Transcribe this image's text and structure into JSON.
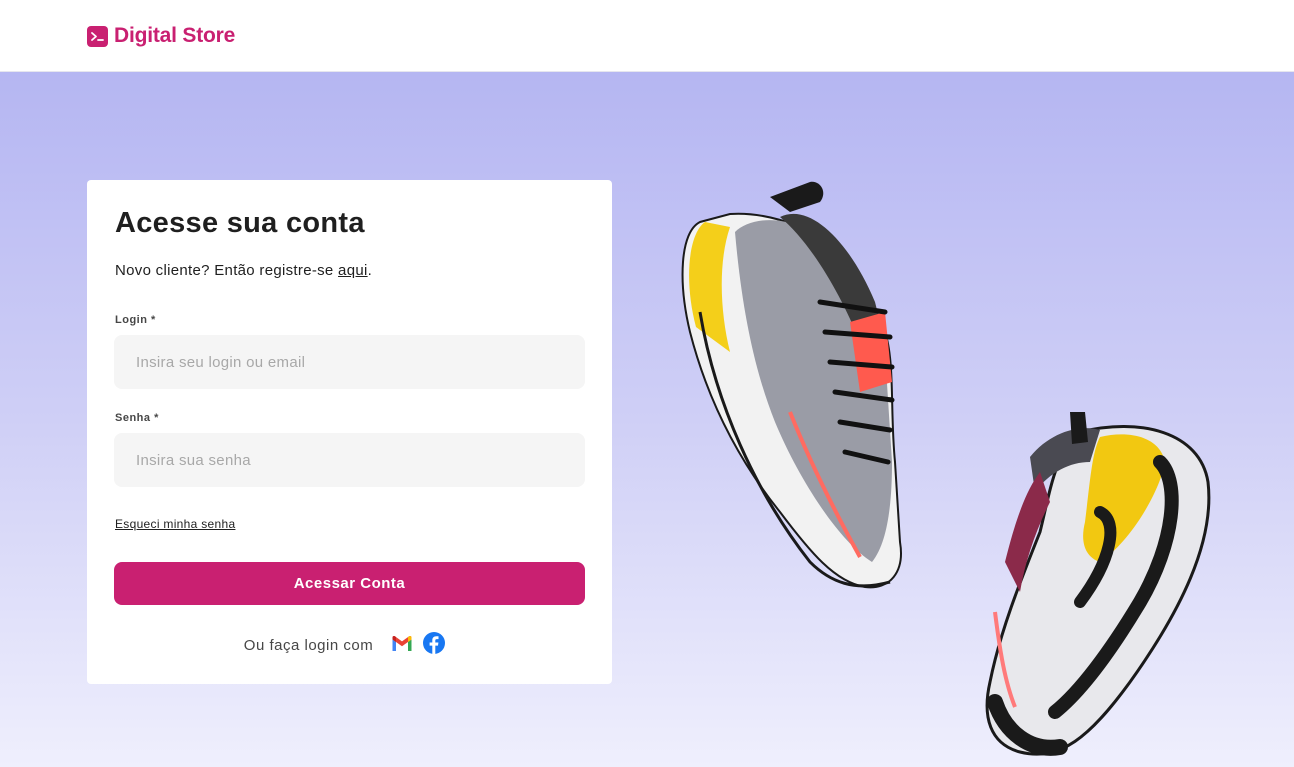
{
  "header": {
    "brand": "Digital Store",
    "logo_icon": "terminal-icon"
  },
  "login": {
    "title": "Acesse sua conta",
    "subtitle_prefix": "Novo cliente? Então registre-se ",
    "subtitle_link": "aqui",
    "subtitle_suffix": ".",
    "login_label": "Login *",
    "login_placeholder": "Insira seu login ou email",
    "login_value": "",
    "password_label": "Senha *",
    "password_placeholder": "Insira sua senha",
    "password_value": "",
    "forgot_link": "Esqueci minha senha",
    "submit_label": "Acessar Conta",
    "social_text": "Ou faça login com",
    "social_icons": [
      "gmail-icon",
      "facebook-icon"
    ]
  },
  "colors": {
    "brand": "#c92071",
    "background_top": "#b5b6f2",
    "background_bottom": "#efeffd",
    "field_background": "#f5f5f5",
    "text_dark": "#1f1f1f",
    "text_gray": "#474747"
  }
}
